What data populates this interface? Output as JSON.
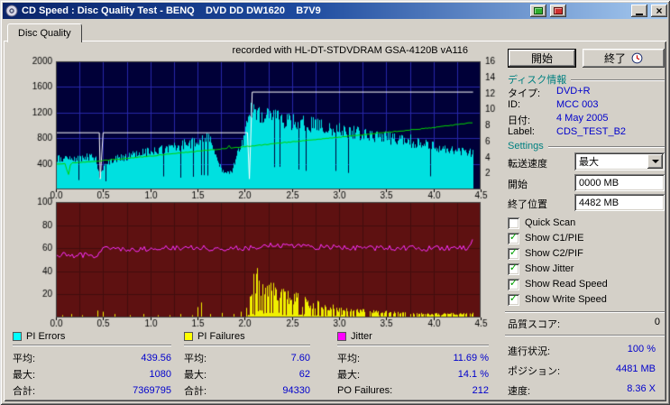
{
  "window": {
    "title": "CD Speed : Disc Quality Test - BENQ    DVD DD DW1620    B7V9"
  },
  "icons": {
    "check": "✓",
    "close": "×"
  },
  "tab": {
    "label": "Disc Quality"
  },
  "chart_data": [
    {
      "type": "area",
      "title": "recorded with HL-DT-STDVDRAM GSA-4120B vA116",
      "x_range": [
        0,
        4.5
      ],
      "x_ticks": [
        "0.0",
        "0.5",
        "1.0",
        "1.5",
        "2.0",
        "2.5",
        "3.0",
        "3.5",
        "4.0",
        "4.5"
      ],
      "ylim": [
        0,
        2000
      ],
      "y_left_ticks": [
        400,
        800,
        1200,
        1600,
        2000
      ],
      "y_right_ticks": [
        2,
        4,
        6,
        8,
        10,
        12,
        14,
        16
      ],
      "y_right_lim": [
        0,
        16
      ],
      "bg": "#000038",
      "grid": "#2727a8",
      "series": [
        {
          "name": "PI Errors",
          "type": "noisy_area",
          "color": "#00e0e0",
          "noise": 0.22,
          "points": [
            [
              0,
              545
            ],
            [
              0.1,
              560
            ],
            [
              0.2,
              545
            ],
            [
              0.3,
              565
            ],
            [
              0.42,
              560
            ],
            [
              0.46,
              215
            ],
            [
              0.52,
              430
            ],
            [
              0.6,
              525
            ],
            [
              0.7,
              560
            ],
            [
              0.8,
              600
            ],
            [
              0.9,
              640
            ],
            [
              1.0,
              665
            ],
            [
              1.1,
              700
            ],
            [
              1.2,
              735
            ],
            [
              1.3,
              770
            ],
            [
              1.4,
              810
            ],
            [
              1.5,
              850
            ],
            [
              1.6,
              890
            ],
            [
              1.65,
              860
            ],
            [
              1.7,
              520
            ],
            [
              1.78,
              265
            ],
            [
              1.86,
              305
            ],
            [
              1.92,
              625
            ],
            [
              2.0,
              905
            ],
            [
              2.04,
              1390
            ],
            [
              2.1,
              1330
            ],
            [
              2.2,
              1285
            ],
            [
              2.35,
              1235
            ],
            [
              2.5,
              1185
            ],
            [
              2.7,
              1135
            ],
            [
              2.9,
              1080
            ],
            [
              3.1,
              1020
            ],
            [
              3.3,
              960
            ],
            [
              3.5,
              905
            ],
            [
              3.7,
              850
            ],
            [
              3.9,
              795
            ],
            [
              4.1,
              730
            ],
            [
              4.25,
              685
            ],
            [
              4.42,
              645
            ]
          ]
        },
        {
          "name": "Write Speed",
          "type": "line",
          "color": "#ffffff",
          "points": [
            [
              0,
              885
            ],
            [
              0.46,
              885
            ],
            [
              0.47,
              165
            ],
            [
              0.5,
              885
            ],
            [
              2.03,
              885
            ],
            [
              2.05,
              165
            ],
            [
              2.08,
              1520
            ],
            [
              4.42,
              1520
            ]
          ]
        },
        {
          "name": "Read Speed",
          "type": "noisy_line",
          "color": "#00d400",
          "noise": 12,
          "spike": [
            0.03,
            60
          ],
          "points": [
            [
              0,
              395
            ],
            [
              0.1,
              405
            ],
            [
              0.13,
              215
            ],
            [
              0.17,
              410
            ],
            [
              0.5,
              450
            ],
            [
              1.0,
              520
            ],
            [
              1.5,
              595
            ],
            [
              2.0,
              668
            ],
            [
              2.5,
              742
            ],
            [
              3.0,
              815
            ],
            [
              3.5,
              890
            ],
            [
              4.0,
              965
            ],
            [
              4.42,
              1045
            ]
          ]
        }
      ]
    },
    {
      "type": "area",
      "x_range": [
        0,
        4.5
      ],
      "x_ticks": [
        "0.0",
        "0.5",
        "1.0",
        "1.5",
        "2.0",
        "2.5",
        "3.0",
        "3.5",
        "4.0",
        "4.5"
      ],
      "ylim": [
        0,
        100
      ],
      "y_left_ticks": [
        20,
        40,
        60,
        80,
        100
      ],
      "bg": "#5e1111",
      "grid": "#430d0d",
      "series": [
        {
          "name": "PI Failures",
          "type": "noisy_area",
          "color": "#f0f000",
          "noise": 0.55,
          "gap": 0.3,
          "points": [
            [
              0,
              0
            ],
            [
              2.0,
              0
            ],
            [
              2.03,
              18
            ],
            [
              2.06,
              34
            ],
            [
              2.1,
              46
            ],
            [
              2.15,
              43
            ],
            [
              2.2,
              39
            ],
            [
              2.3,
              33
            ],
            [
              2.4,
              28
            ],
            [
              2.5,
              24
            ],
            [
              2.6,
              20
            ],
            [
              2.7,
              17
            ],
            [
              2.8,
              14
            ],
            [
              2.9,
              12
            ],
            [
              3.0,
              10
            ],
            [
              3.15,
              8
            ],
            [
              3.3,
              7
            ],
            [
              3.5,
              6
            ],
            [
              3.7,
              5
            ],
            [
              3.9,
              4
            ],
            [
              4.1,
              4
            ],
            [
              4.3,
              4
            ],
            [
              4.42,
              5
            ]
          ],
          "spikes": [
            [
              0.07,
              2
            ],
            [
              0.16,
              3
            ],
            [
              0.28,
              2
            ],
            [
              0.44,
              6
            ],
            [
              0.5,
              5
            ],
            [
              0.62,
              3
            ],
            [
              0.78,
              2
            ],
            [
              0.93,
              3
            ],
            [
              1.08,
              2
            ],
            [
              1.2,
              2
            ],
            [
              1.32,
              3
            ],
            [
              1.44,
              2
            ],
            [
              1.5,
              9
            ],
            [
              1.54,
              13
            ],
            [
              1.63,
              3
            ],
            [
              1.76,
              4
            ],
            [
              1.88,
              3
            ],
            [
              1.96,
              5
            ]
          ]
        },
        {
          "name": "Jitter",
          "type": "noisy_line",
          "color": "#ff30ff",
          "noise": 5,
          "points": [
            [
              0,
              54
            ],
            [
              0.2,
              54
            ],
            [
              0.44,
              54
            ],
            [
              0.48,
              59
            ],
            [
              0.8,
              59
            ],
            [
              1.2,
              60
            ],
            [
              1.6,
              60
            ],
            [
              2.0,
              60
            ],
            [
              2.2,
              62
            ],
            [
              2.35,
              63
            ],
            [
              2.5,
              62
            ],
            [
              2.8,
              61
            ],
            [
              3.2,
              60
            ],
            [
              3.6,
              60
            ],
            [
              4.0,
              60
            ],
            [
              4.3,
              60
            ],
            [
              4.36,
              61
            ],
            [
              4.42,
              66
            ]
          ]
        }
      ]
    }
  ],
  "right_panel": {
    "start_button": "開始",
    "exit_button": "終了",
    "disc_info": {
      "header": "ディスク情報",
      "rows": [
        {
          "label": "タイプ:",
          "value": "DVD+R"
        },
        {
          "label": "ID:",
          "value": "MCC 003"
        },
        {
          "label": "日付:",
          "value": "4 May 2005"
        },
        {
          "label": "Label:",
          "value": "CDS_TEST_B2"
        }
      ]
    },
    "settings": {
      "header": "Settings",
      "speed_label": "転送速度",
      "speed_value": "最大",
      "start_label": "開始",
      "start_value": "0000 MB",
      "end_label": "終了位置",
      "end_value": "4482 MB",
      "checkboxes": [
        {
          "label": "Quick Scan",
          "checked": false
        },
        {
          "label": "Show C1/PIE",
          "checked": true
        },
        {
          "label": "Show C2/PIF",
          "checked": true
        },
        {
          "label": "Show Jitter",
          "checked": true
        },
        {
          "label": "Show Read Speed",
          "checked": true
        },
        {
          "label": "Show Write Speed",
          "checked": true
        }
      ]
    },
    "quality_score": {
      "label": "品質スコア:",
      "value": "0"
    },
    "progress_rows": [
      {
        "label": "進行状況:",
        "value": "100 %"
      },
      {
        "label": "ポジション:",
        "value": "4481 MB"
      },
      {
        "label": "速度:",
        "value": "8.36 X"
      }
    ]
  },
  "stats": {
    "columns": [
      {
        "name": "PI Errors",
        "swatch": "#00ffff",
        "rows": [
          {
            "label": "平均:",
            "value": "439.56"
          },
          {
            "label": "最大:",
            "value": "1080"
          },
          {
            "label": "合計:",
            "value": "7369795"
          }
        ]
      },
      {
        "name": "PI Failures",
        "swatch": "#ffff00",
        "rows": [
          {
            "label": "平均:",
            "value": "7.60"
          },
          {
            "label": "最大:",
            "value": "62"
          },
          {
            "label": "合計:",
            "value": "94330"
          }
        ]
      },
      {
        "name": "Jitter",
        "swatch": "#ff00ff",
        "rows": [
          {
            "label": "平均:",
            "value": "11.69 %"
          },
          {
            "label": "最大:",
            "value": "14.1 %"
          },
          {
            "label": "PO Failures:",
            "value": "212"
          }
        ]
      }
    ]
  }
}
